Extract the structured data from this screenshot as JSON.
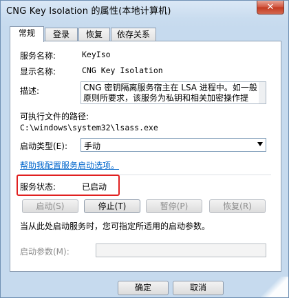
{
  "window": {
    "title": "CNG Key Isolation 的属性(本地计算机)",
    "close_label": "✕"
  },
  "tabs": [
    {
      "label": "常规",
      "active": true
    },
    {
      "label": "登录",
      "active": false
    },
    {
      "label": "恢复",
      "active": false
    },
    {
      "label": "依存关系",
      "active": false
    }
  ],
  "general": {
    "service_name_label": "服务名称:",
    "service_name_value": "KeyIso",
    "display_name_label": "显示名称:",
    "display_name_value": "CNG Key Isolation",
    "description_label": "描述:",
    "description_value": "CNG 密钥隔离服务宿主在 LSA 进程中。如一般原则所要求，该服务为私钥和相关加密操作提",
    "exe_path_label": "可执行文件的路径:",
    "exe_path_value": "C:\\windows\\system32\\lsass.exe",
    "startup_type_label": "启动类型(E):",
    "startup_type_value": "手动",
    "help_link": "帮助我配置服务启动选项。",
    "status_label": "服务状态:",
    "status_value": "已启动",
    "buttons": {
      "start": "启动(S)",
      "stop": "停止(T)",
      "pause": "暂停(P)",
      "resume": "恢复(R)"
    },
    "hint_text": "当从此处启动服务时，您可指定所适用的启动参数。",
    "start_params_label": "启动参数(M):",
    "start_params_value": ""
  },
  "footer": {
    "ok": "确定",
    "cancel": "取消"
  }
}
